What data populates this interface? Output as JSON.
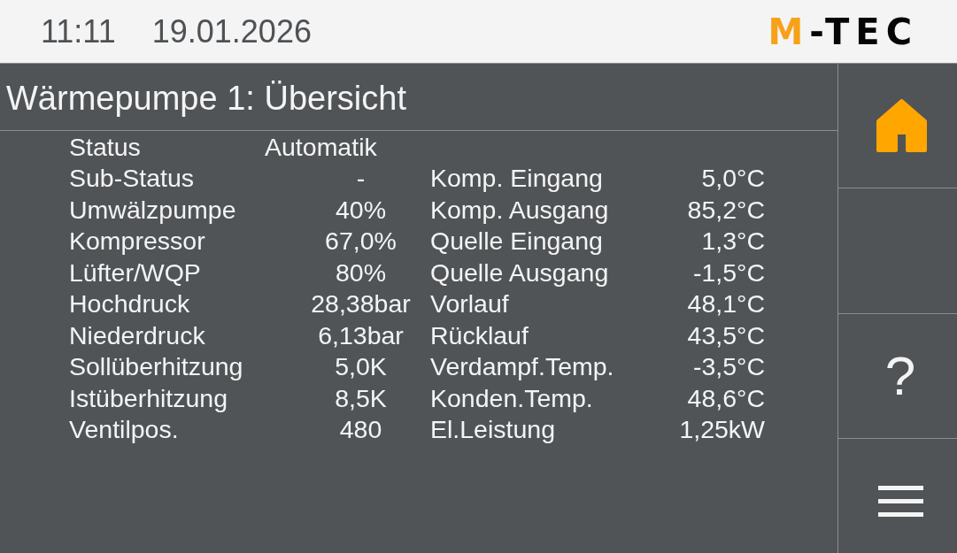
{
  "header": {
    "time": "11:11",
    "date": "19.01.2026",
    "logo": {
      "accent": "M",
      "rest": "-TEC"
    }
  },
  "page_title": "Wärmepumpe 1: Übersicht",
  "left_readings": [
    {
      "kind": "status",
      "label": "Status",
      "value": "Automatik"
    },
    {
      "kind": "reading",
      "label": "Sub-Status",
      "value": "-"
    },
    {
      "kind": "reading",
      "label": "Umwälzpumpe",
      "value": "40%"
    },
    {
      "kind": "reading",
      "label": "Kompressor",
      "value": "67,0%"
    },
    {
      "kind": "reading",
      "label": "Lüfter/WQP",
      "value": "80%"
    },
    {
      "kind": "reading",
      "label": "Hochdruck",
      "value": "28,38bar"
    },
    {
      "kind": "reading",
      "label": "Niederdruck",
      "value": "6,13bar"
    },
    {
      "kind": "reading",
      "label": "Sollüberhitzung",
      "value": "5,0K"
    },
    {
      "kind": "reading",
      "label": "Istüberhitzung",
      "value": "8,5K"
    },
    {
      "kind": "reading",
      "label": "Ventilpos.",
      "value": "480"
    }
  ],
  "right_readings": [
    {
      "label": "Komp. Eingang",
      "value": "5,0°C"
    },
    {
      "label": "Komp. Ausgang",
      "value": "85,2°C"
    },
    {
      "label": "Quelle Eingang",
      "value": "1,3°C"
    },
    {
      "label": "Quelle Ausgang",
      "value": "-1,5°C"
    },
    {
      "label": "Vorlauf",
      "value": "48,1°C"
    },
    {
      "label": "Rücklauf",
      "value": "43,5°C"
    },
    {
      "label": "Verdampf.Temp.",
      "value": "-3,5°C"
    },
    {
      "label": "Konden.Temp.",
      "value": "48,6°C"
    },
    {
      "label": "El.Leistung",
      "value": "1,25kW"
    }
  ],
  "sidebar": [
    {
      "kind": "home"
    },
    {
      "kind": "empty"
    },
    {
      "kind": "help",
      "label": "?"
    },
    {
      "kind": "menu"
    }
  ]
}
